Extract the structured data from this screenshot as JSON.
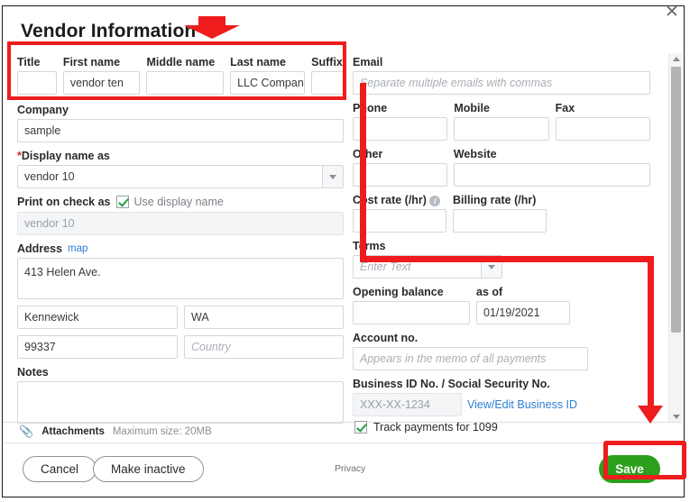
{
  "dialog": {
    "title": "Vendor Information",
    "close_icon": "close-icon"
  },
  "name_row": {
    "title": {
      "label": "Title",
      "value": ""
    },
    "first_name": {
      "label": "First name",
      "value": "vendor ten"
    },
    "middle_name": {
      "label": "Middle name",
      "value": ""
    },
    "last_name": {
      "label": "Last name",
      "value": "LLC Company"
    },
    "suffix": {
      "label": "Suffix",
      "value": ""
    }
  },
  "left": {
    "company": {
      "label": "Company",
      "value": "sample"
    },
    "display_name": {
      "label": "Display name as",
      "required_marker": "*",
      "value": "vendor 10"
    },
    "print_on_check": {
      "label": "Print on check as",
      "checkbox_label": "Use display name",
      "checked": true,
      "value": "vendor 10"
    },
    "address": {
      "label": "Address",
      "map_link": "map",
      "street": "413 Helen Ave.",
      "city": "Kennewick",
      "state": "WA",
      "zip": "99337",
      "country_placeholder": "Country"
    },
    "notes": {
      "label": "Notes",
      "value": ""
    }
  },
  "right": {
    "email": {
      "label": "Email",
      "placeholder": "Separate multiple emails with commas",
      "value": ""
    },
    "phone": {
      "label": "Phone",
      "value": ""
    },
    "mobile": {
      "label": "Mobile",
      "value": ""
    },
    "fax": {
      "label": "Fax",
      "value": ""
    },
    "other": {
      "label": "Other",
      "value": ""
    },
    "website": {
      "label": "Website",
      "value": ""
    },
    "cost_rate": {
      "label": "Cost rate (/hr)",
      "info_icon": "info-icon",
      "value": ""
    },
    "billing_rate": {
      "label": "Billing rate (/hr)",
      "value": ""
    },
    "terms": {
      "label": "Terms",
      "placeholder": "Enter Text",
      "value": ""
    },
    "opening_balance": {
      "label": "Opening balance",
      "value": ""
    },
    "as_of": {
      "label": "as of",
      "value": "01/19/2021"
    },
    "account_no": {
      "label": "Account no.",
      "placeholder": "Appears in the memo of all payments",
      "value": ""
    },
    "business_id": {
      "label": "Business ID No. / Social Security No.",
      "value": "XXX-XX-1234",
      "link": "View/Edit Business ID"
    },
    "track_1099": {
      "label": "Track payments for 1099",
      "checked": true
    }
  },
  "attachments": {
    "icon": "paperclip-icon",
    "label": "Attachments",
    "max_size": "Maximum size: 20MB"
  },
  "footer": {
    "cancel": "Cancel",
    "make_inactive": "Make inactive",
    "privacy": "Privacy",
    "save": "Save"
  },
  "annotations": {
    "highlight_color": "#EE1C1C",
    "save_accent_color": "#2CA01C",
    "title_arrow": "red-down-arrow",
    "pointer_arrow": "red-down-arrow"
  },
  "scrollbar": {
    "up_icon": "scroll-up-arrow-icon",
    "down_icon": "scroll-down-arrow-icon"
  }
}
